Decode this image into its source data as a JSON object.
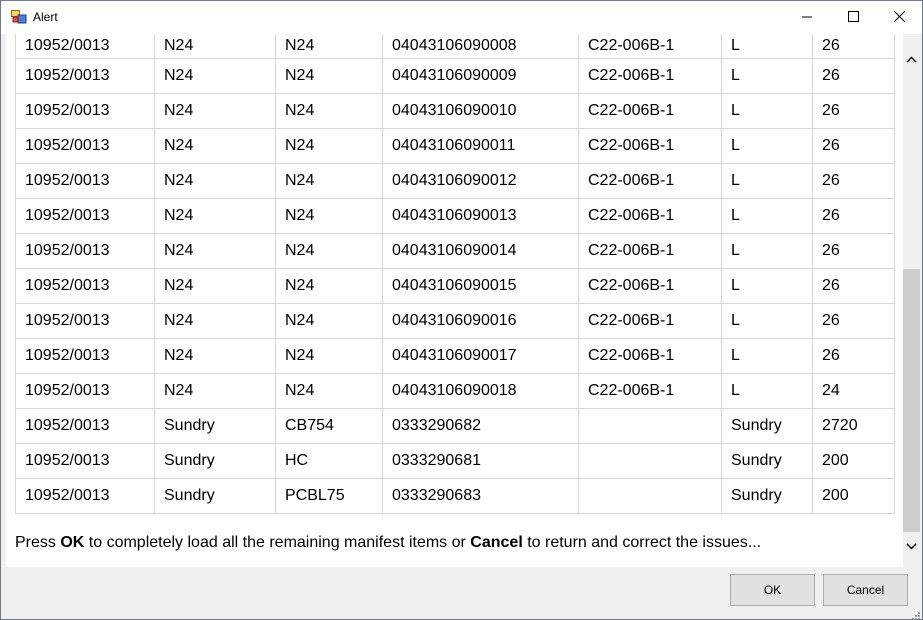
{
  "window": {
    "title": "Alert"
  },
  "table": {
    "rows": [
      [
        "10952/0013",
        "N24",
        "N24",
        "04043106090008",
        "C22-006B-1",
        "L",
        "26"
      ],
      [
        "10952/0013",
        "N24",
        "N24",
        "04043106090009",
        "C22-006B-1",
        "L",
        "26"
      ],
      [
        "10952/0013",
        "N24",
        "N24",
        "04043106090010",
        "C22-006B-1",
        "L",
        "26"
      ],
      [
        "10952/0013",
        "N24",
        "N24",
        "04043106090011",
        "C22-006B-1",
        "L",
        "26"
      ],
      [
        "10952/0013",
        "N24",
        "N24",
        "04043106090012",
        "C22-006B-1",
        "L",
        "26"
      ],
      [
        "10952/0013",
        "N24",
        "N24",
        "04043106090013",
        "C22-006B-1",
        "L",
        "26"
      ],
      [
        "10952/0013",
        "N24",
        "N24",
        "04043106090014",
        "C22-006B-1",
        "L",
        "26"
      ],
      [
        "10952/0013",
        "N24",
        "N24",
        "04043106090015",
        "C22-006B-1",
        "L",
        "26"
      ],
      [
        "10952/0013",
        "N24",
        "N24",
        "04043106090016",
        "C22-006B-1",
        "L",
        "26"
      ],
      [
        "10952/0013",
        "N24",
        "N24",
        "04043106090017",
        "C22-006B-1",
        "L",
        "26"
      ],
      [
        "10952/0013",
        "N24",
        "N24",
        "04043106090018",
        "C22-006B-1",
        "L",
        "24"
      ],
      [
        "10952/0013",
        "Sundry",
        "CB754",
        "0333290682",
        "",
        "Sundry",
        "2720"
      ],
      [
        "10952/0013",
        "Sundry",
        "HC",
        "0333290681",
        "",
        "Sundry",
        "200"
      ],
      [
        "10952/0013",
        "Sundry",
        "PCBL75",
        "0333290683",
        "",
        "Sundry",
        "200"
      ]
    ]
  },
  "message": {
    "part1": "Press ",
    "ok_word": "OK",
    "part2": " to completely load all the remaining manifest items or ",
    "cancel_word": "Cancel",
    "part3": " to return and correct the issues..."
  },
  "buttons": {
    "ok_label": "OK",
    "cancel_label": "Cancel"
  },
  "icons": {
    "app": "app-window-icon",
    "minimize": "minimize-icon",
    "maximize": "maximize-icon",
    "close": "close-icon",
    "scroll_up": "chevron-up-icon",
    "scroll_down": "chevron-down-icon",
    "grip": "resize-grip-icon"
  }
}
